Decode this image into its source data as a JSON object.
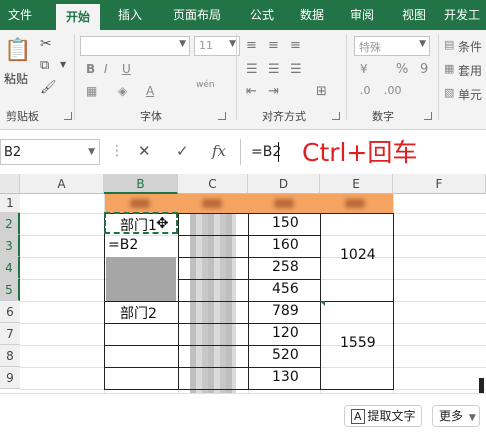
{
  "tabs": [
    {
      "label": "文件",
      "active": false
    },
    {
      "label": "开始",
      "active": true
    },
    {
      "label": "插入",
      "active": false
    },
    {
      "label": "页面布局",
      "active": false
    },
    {
      "label": "公式",
      "active": false
    },
    {
      "label": "数据",
      "active": false
    },
    {
      "label": "审阅",
      "active": false
    },
    {
      "label": "视图",
      "active": false
    },
    {
      "label": "开发工",
      "active": false
    }
  ],
  "ribbon": {
    "clipboard": {
      "paste_label": "粘贴",
      "group_label": "剪贴板"
    },
    "font": {
      "name_value": "",
      "size_value": "11",
      "bold": "B",
      "italic": "I",
      "underline": "U",
      "phonetic": "wén",
      "group_label": "字体"
    },
    "alignment": {
      "group_label": "对齐方式"
    },
    "number": {
      "format_value": "特殊",
      "percent": "%",
      "comma": "9",
      "group_label": "数字"
    },
    "styles": {
      "conditional": "条件",
      "table": "套用",
      "cell": "单元"
    }
  },
  "formula_bar": {
    "name_box": "B2",
    "fx_label": "fx",
    "formula": "=B2"
  },
  "overlay": {
    "text": "Ctrl+回车"
  },
  "columns": [
    "A",
    "B",
    "C",
    "D",
    "E",
    "F"
  ],
  "rows": [
    "1",
    "2",
    "3",
    "4",
    "5",
    "6",
    "7",
    "8",
    "9"
  ],
  "cells": {
    "b2": "部门1",
    "b3": "=B2",
    "b6": "部门2",
    "d_values": [
      "150",
      "160",
      "258",
      "456",
      "789",
      "120",
      "520",
      "130"
    ],
    "e_group1": "1024",
    "e_group2": "1559"
  },
  "colors": {
    "accent": "#217346",
    "header_band": "#f4a460",
    "overlay_text": "#e02020"
  },
  "bottom_bar": {
    "extract_text": "提取文字",
    "more": "更多"
  }
}
